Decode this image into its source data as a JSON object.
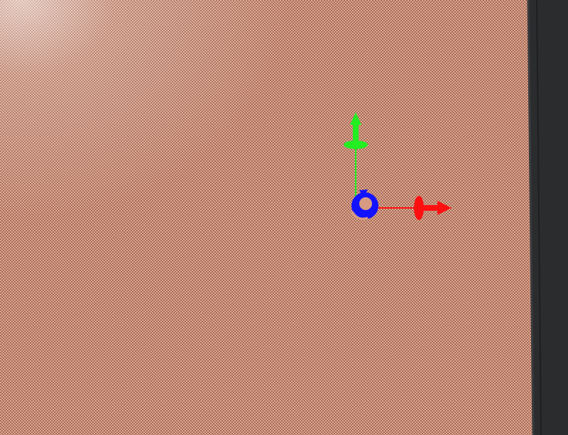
{
  "viewport": {
    "surface_color": "#d79a82",
    "checker_dark": "#7a4a3a",
    "checker_light": "#e7b29c",
    "background_color": "#2b2c2e"
  },
  "gizmo": {
    "x_axis_color": "#ff1010",
    "y_axis_color": "#22ee22",
    "z_axis_color": "#1212ff",
    "icons": [
      "translate-x-arrow-icon",
      "translate-y-arrow-icon",
      "rotate-z-icon"
    ]
  }
}
